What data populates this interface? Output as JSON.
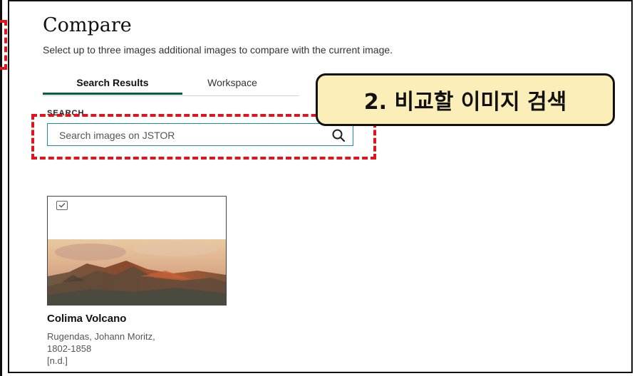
{
  "panel": {
    "title": "Compare",
    "subtitle": "Select up to three images additional images to compare with the current image."
  },
  "tabs": [
    {
      "label": "Search Results",
      "active": true
    },
    {
      "label": "Workspace",
      "active": false
    }
  ],
  "search": {
    "label": "SEARCH",
    "placeholder": "Search images on JSTOR",
    "value": "",
    "icon": "search-icon"
  },
  "annotation": {
    "text": "2. 비교할 이미지 검색",
    "highlight_color": "#e0141c",
    "callout_color": "#fbeeb8"
  },
  "results": [
    {
      "title": "Colima Volcano",
      "creator": "Rugendas, Johann Moritz,",
      "dates": "1802-1858",
      "date": "[n.d.]",
      "selected": false,
      "icon": "checkbox-icon"
    }
  ],
  "colors": {
    "accent": "#0d5c4a",
    "input_border": "#1c8fa8"
  }
}
